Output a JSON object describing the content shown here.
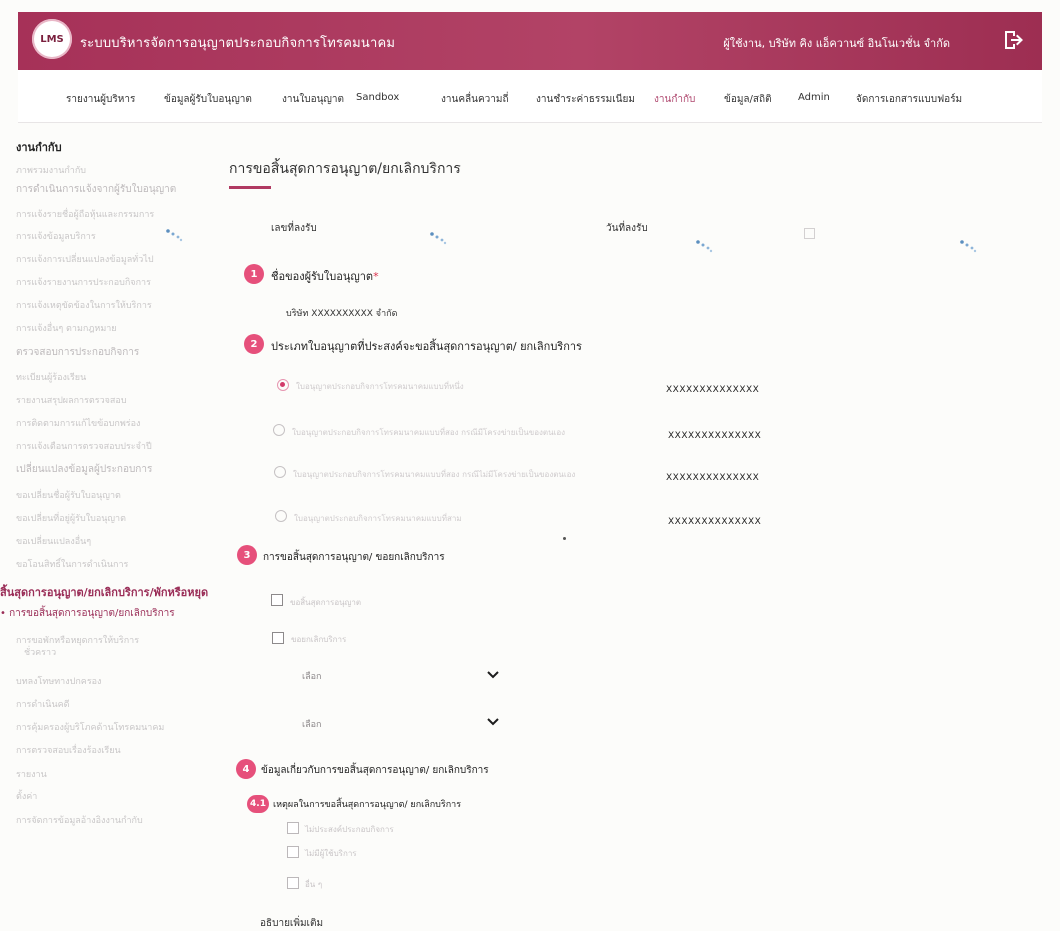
{
  "header": {
    "logo_text": "LMS",
    "app_title": "ระบบบริหารจัดการอนุญาตประกอบกิจการโทรคมนาคม",
    "user_info": "ผู้ใช้งาน, บริษัท คิง แอ็ควานซ์ อินโนเวชั่น จำกัด",
    "brand_color": "#a63158"
  },
  "nav": {
    "items": [
      {
        "label": "รายงานผู้บริหาร"
      },
      {
        "label": "ข้อมูลผู้รับใบอนุญาต"
      },
      {
        "label": "งานใบอนุญาต"
      },
      {
        "label": "Sandbox"
      },
      {
        "label": "งานคลื่นความถี่"
      },
      {
        "label": "งานชำระค่าธรรมเนียม"
      },
      {
        "label": "งานกำกับ"
      },
      {
        "label": "ข้อมูล/สถิติ"
      },
      {
        "label": "Admin"
      },
      {
        "label": "จัดการเอกสารแบบฟอร์ม"
      }
    ]
  },
  "sidebar": {
    "title": "งานกำกับ",
    "items": [
      {
        "label": "ภาพรวมงานกำกับ"
      },
      {
        "label": "การดำเนินการแจ้งจากผู้รับใบอนุญาต"
      },
      {
        "label": "การแจ้งรายชื่อผู้ถือหุ้นและกรรมการ"
      },
      {
        "label": "การแจ้งข้อมูลบริการ"
      },
      {
        "label": "การแจ้งการเปลี่ยนแปลงข้อมูลทั่วไป"
      },
      {
        "label": "การแจ้งรายงานการประกอบกิจการ"
      },
      {
        "label": "การแจ้งเหตุขัดข้องในการให้บริการ"
      },
      {
        "label": "การแจ้งอื่นๆ ตามกฎหมาย"
      },
      {
        "label": "ตรวจสอบการประกอบกิจการ"
      },
      {
        "label": "ทะเบียนผู้ร้องเรียน"
      },
      {
        "label": "รายงานสรุปผลการตรวจสอบ"
      },
      {
        "label": "การติดตามการแก้ไขข้อบกพร่อง"
      },
      {
        "label": "การแจ้งเตือนการตรวจสอบประจำปี"
      },
      {
        "label": "เปลี่ยนแปลงข้อมูลผู้ประกอบการ"
      },
      {
        "label": "ขอเปลี่ยนชื่อผู้รับใบอนุญาต"
      },
      {
        "label": "ขอเปลี่ยนที่อยู่ผู้รับใบอนุญาต"
      },
      {
        "label": "ขอเปลี่ยนแปลงอื่นๆ"
      },
      {
        "label": "ขอโอนสิทธิ์ในการดำเนินการ"
      },
      {
        "label": "สิ้นสุดการอนุญาต/ยกเลิกบริการ/พักหรือหยุด"
      },
      {
        "label": "การขอสิ้นสุดการอนุญาต/ยกเลิกบริการ"
      },
      {
        "label": "การขอพักหรือหยุดการให้บริการ"
      },
      {
        "label": "ชั่วคราว"
      },
      {
        "label": "บทลงโทษทางปกครอง"
      },
      {
        "label": "การดำเนินคดี"
      },
      {
        "label": "การคุ้มครองผู้บริโภคด้านโทรคมนาคม"
      },
      {
        "label": "การตรวจสอบเรื่องร้องเรียน"
      },
      {
        "label": "รายงาน"
      },
      {
        "label": "ตั้งค่า"
      },
      {
        "label": "การจัดการข้อมูลอ้างอิงงานกำกับ"
      }
    ]
  },
  "main": {
    "page_title": "การขอสิ้นสุดการอนุญาต/ยกเลิกบริการ",
    "receipt_no_label": "เลขที่ลงรับ",
    "receipt_date_label": "วันที่ลงรับ",
    "step1": {
      "num": "1",
      "title": "ชื่อของผู้รับใบอนุญาต",
      "required_mark": "*",
      "value": "บริษัท XXXXXXXXXX จำกัด"
    },
    "step2": {
      "num": "2",
      "title": "ประเภทใบอนุญาตที่ประสงค์จะขอสิ้นสุดการอนุญาต/ ยกเลิกบริการ",
      "options": [
        {
          "label": "ใบอนุญาตประกอบกิจการโทรคมนาคมแบบที่หนึ่ง",
          "license_no": "XXXXXXXXXXXXXX",
          "checked": true
        },
        {
          "label": "ใบอนุญาตประกอบกิจการโทรคมนาคมแบบที่สอง กรณีมีโครงข่ายเป็นของตนเอง",
          "license_no": "XXXXXXXXXXXXXX",
          "checked": false
        },
        {
          "label": "ใบอนุญาตประกอบกิจการโทรคมนาคมแบบที่สอง กรณีไม่มีโครงข่ายเป็นของตนเอง",
          "license_no": "XXXXXXXXXXXXXX",
          "checked": false
        },
        {
          "label": "ใบอนุญาตประกอบกิจการโทรคมนาคมแบบที่สาม",
          "license_no": "XXXXXXXXXXXXXX",
          "checked": false
        }
      ]
    },
    "step3": {
      "num": "3",
      "title": "การขอสิ้นสุดการอนุญาต/ ขอยกเลิกบริการ",
      "checkboxes": [
        {
          "label": "ขอสิ้นสุดการอนุญาต"
        },
        {
          "label": "ขอยกเลิกบริการ"
        }
      ],
      "selects": [
        {
          "value": "เลือก"
        },
        {
          "value": "เลือก"
        }
      ]
    },
    "step4": {
      "num": "4",
      "title": "ข้อมูลเกี่ยวกับการขอสิ้นสุดการอนุญาต/ ยกเลิกบริการ",
      "sub_num": "4.1",
      "sub_title": "เหตุผลในการขอสิ้นสุดการอนุญาต/ ยกเลิกบริการ",
      "reasons": [
        {
          "label": "ไม่ประสงค์ประกอบกิจการ"
        },
        {
          "label": "ไม่มีผู้ใช้บริการ"
        },
        {
          "label": "อื่น ๆ"
        }
      ],
      "more_label": "อธิบายเพิ่มเติม"
    }
  }
}
